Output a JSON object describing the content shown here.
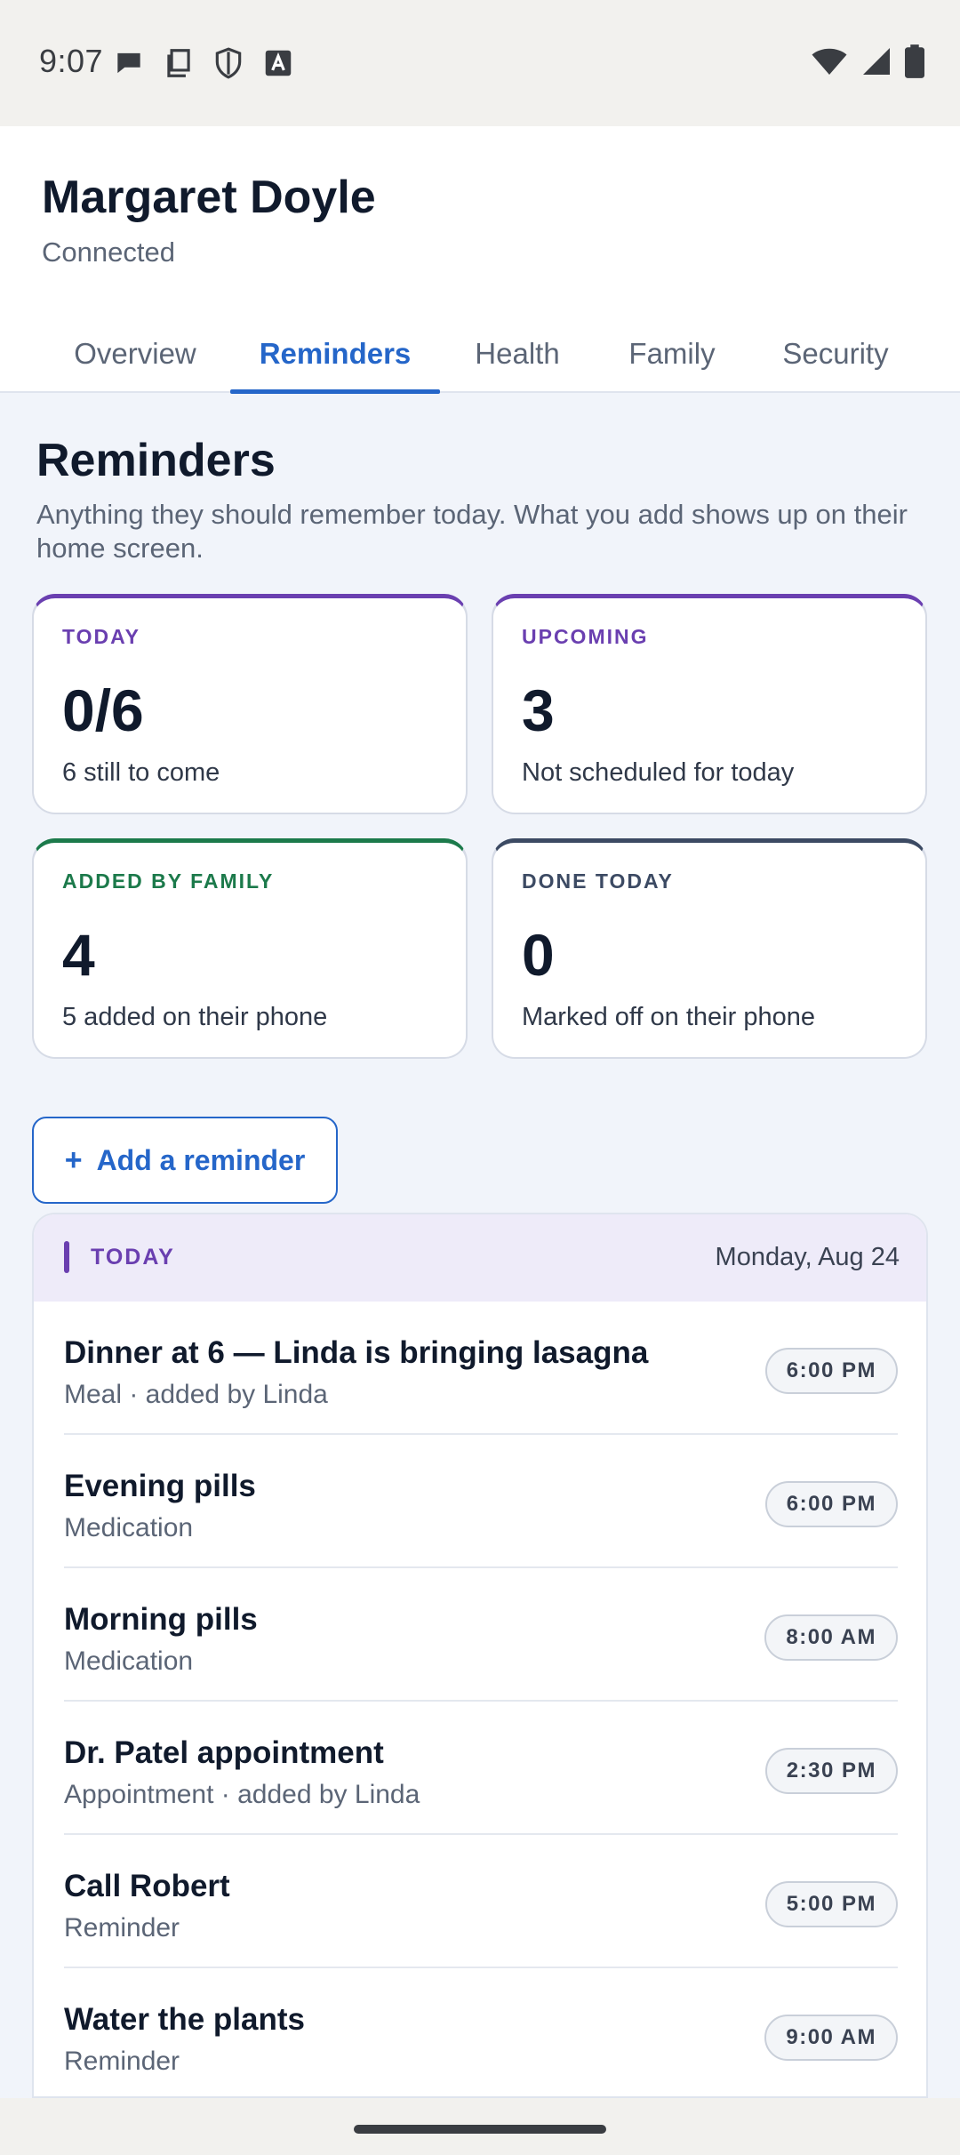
{
  "status_bar": {
    "time": "9:07",
    "left_icons": [
      "chat-bubble-icon",
      "copy-icon",
      "shield-icon",
      "text-a-icon"
    ],
    "right_icons": [
      "wifi-icon",
      "signal-icon",
      "battery-icon"
    ]
  },
  "header": {
    "name": "Margaret Doyle",
    "status": "Connected"
  },
  "tabs": [
    {
      "label": "Overview",
      "active": false
    },
    {
      "label": "Reminders",
      "active": true
    },
    {
      "label": "Health",
      "active": false
    },
    {
      "label": "Family",
      "active": false
    },
    {
      "label": "Security",
      "active": false
    }
  ],
  "section": {
    "title": "Reminders",
    "description": "Anything they should remember today. What you add shows up on their home screen."
  },
  "stats": [
    {
      "label": "TODAY",
      "value": "0/6",
      "sub": "6 still to come",
      "accent": "#6a3fb0"
    },
    {
      "label": "UPCOMING",
      "value": "3",
      "sub": "Not scheduled for today",
      "accent": "#6a3fb0"
    },
    {
      "label": "ADDED BY FAMILY",
      "value": "4",
      "sub": "5 added on their phone",
      "accent": "#1c7a4b"
    },
    {
      "label": "DONE TODAY",
      "value": "0",
      "sub": "Marked off on their phone",
      "accent": "#3c4a63"
    }
  ],
  "add_button": {
    "plus": "+",
    "label": "Add a reminder"
  },
  "list": {
    "header_label": "TODAY",
    "date": "Monday, Aug 24",
    "items": [
      {
        "title": "Dinner at 6 — Linda is bringing lasagna",
        "sub": "Meal · added by Linda",
        "time": "6:00 PM"
      },
      {
        "title": "Evening pills",
        "sub": "Medication",
        "time": "6:00 PM"
      },
      {
        "title": "Morning pills",
        "sub": "Medication",
        "time": "8:00 AM"
      },
      {
        "title": "Dr. Patel appointment",
        "sub": "Appointment · added by Linda",
        "time": "2:30 PM"
      },
      {
        "title": "Call Robert",
        "sub": "Reminder",
        "time": "5:00 PM"
      },
      {
        "title": "Water the plants",
        "sub": "Reminder",
        "time": "9:00 AM"
      }
    ]
  },
  "colors": {
    "accent_blue": "#2566c9",
    "accent_purple": "#6a3fb0",
    "accent_green": "#1c7a4b",
    "page_bg": "#f1f4fa"
  }
}
